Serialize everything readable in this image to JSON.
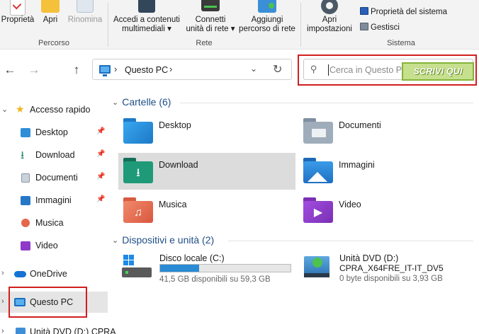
{
  "ribbon": {
    "buttons": [
      {
        "label": "Proprietà"
      },
      {
        "label": "Apri"
      },
      {
        "label": "Rinomina"
      },
      {
        "label": "Accedi a contenuti",
        "label2": "multimediali ▾"
      },
      {
        "label": "Connetti",
        "label2": "unità di rete ▾"
      },
      {
        "label": "Aggiungi",
        "label2": "percorso di rete"
      },
      {
        "label": "Apri",
        "label2": "impostazioni"
      }
    ],
    "small_items": [
      "Proprietà del sistema",
      "Gestisci"
    ],
    "groups": [
      "Percorso",
      "Rete",
      "Sistema"
    ]
  },
  "nav": {
    "back": "←",
    "forward": "→",
    "up": "↑",
    "address_crumb": "Questo PC",
    "address_sep": "›",
    "dropdown": "⌄",
    "refresh": "↻"
  },
  "search": {
    "placeholder": "Cerca in Questo PC",
    "annotation": "SCRIVI QUI"
  },
  "sidebar": {
    "items": [
      {
        "label": "Accesso rapido"
      },
      {
        "label": "Desktop"
      },
      {
        "label": "Download"
      },
      {
        "label": "Documenti"
      },
      {
        "label": "Immagini"
      },
      {
        "label": "Musica"
      },
      {
        "label": "Video"
      },
      {
        "label": "OneDrive"
      },
      {
        "label": "Questo PC"
      },
      {
        "label": "Unità DVD (D:) CPRA"
      }
    ]
  },
  "main": {
    "folders_header": "Cartelle (6)",
    "folders": [
      {
        "name": "Desktop"
      },
      {
        "name": "Documenti"
      },
      {
        "name": "Download"
      },
      {
        "name": "Immagini"
      },
      {
        "name": "Musica"
      },
      {
        "name": "Video"
      }
    ],
    "drives_header": "Dispositivi e unità (2)",
    "drives": [
      {
        "name": "Disco locale (C:)",
        "info": "41,5 GB disponibili su 59,3 GB",
        "used_fraction": 0.3
      },
      {
        "name": "Unità DVD (D:)",
        "label": "CPRA_X64FRE_IT-IT_DV5",
        "info": "0 byte disponibili su 3,93 GB"
      }
    ]
  },
  "colors": {
    "accent": "#1c6fc0",
    "highlight_red": "#d21f1f",
    "annotation_green": "#c6e08e",
    "selection": "#dcdcdc"
  }
}
